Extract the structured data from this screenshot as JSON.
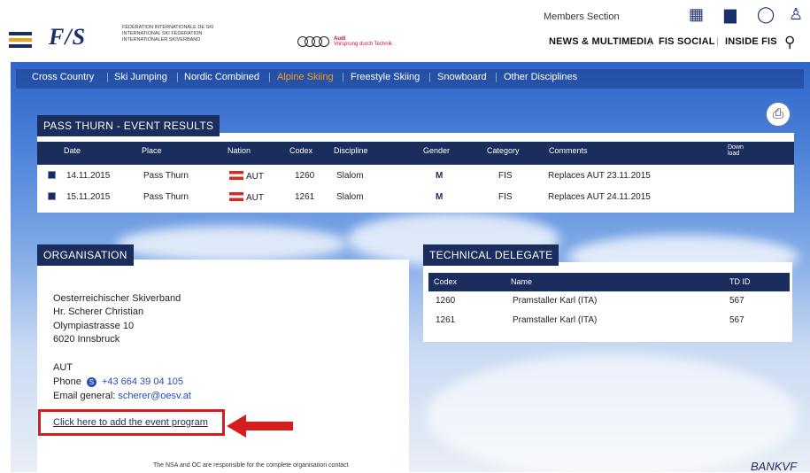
{
  "header": {
    "fis_logo": "F/S",
    "fis_subtitle": "Fédération Internationale de Ski International Ski Federation Internationaler Skiverband",
    "audi_line1": "Audi",
    "audi_line2": "Vorsprung durch Technik",
    "members_section": "Members Section",
    "nav": [
      "NEWS & MULTIMEDIA",
      "FIS SOCIAL",
      "INSIDE FIS"
    ],
    "icons": [
      "calendar-icon",
      "standings-icon",
      "medal-icon",
      "athlete-icon",
      "search-icon"
    ]
  },
  "disciplines": [
    "Cross Country",
    "Ski Jumping",
    "Nordic Combined",
    "Alpine Skiing",
    "Freestyle Skiing",
    "Snowboard",
    "Other Disciplines"
  ],
  "active_discipline": "Alpine Skiing",
  "results": {
    "title": "PASS THURN - EVENT RESULTS",
    "columns": [
      "Date",
      "Place",
      "Nation",
      "Codex",
      "Discipline",
      "Gender",
      "Category",
      "Comments",
      "Down load"
    ],
    "rows": [
      {
        "date": "14.11.2015",
        "place": "Pass Thurn",
        "nation": "AUT",
        "codex": "1260",
        "discipline": "Slalom",
        "gender": "M",
        "category": "FIS",
        "comments": "Replaces AUT 23.11.2015"
      },
      {
        "date": "15.11.2015",
        "place": "Pass Thurn",
        "nation": "AUT",
        "codex": "1261",
        "discipline": "Slalom",
        "gender": "M",
        "category": "FIS",
        "comments": "Replaces AUT 24.11.2015"
      }
    ]
  },
  "organisation": {
    "title": "ORGANISATION",
    "lines": [
      "Oesterreichischer Skiverband",
      "Hr. Scherer Christian",
      "Olympiastrasse 10",
      "6020 Innsbruck"
    ],
    "country": "AUT",
    "phone_label": "Phone",
    "phone": "+43 664 39 04 105",
    "email_label": "Email general",
    "email": "scherer@oesv.at",
    "event_program_link": "Click here to add the event program",
    "footer_note": "The NSA and OC are responsible for the complete organisation contact"
  },
  "technical_delegate": {
    "title": "TECHNICAL DELEGATE",
    "columns": [
      "Codex",
      "Name",
      "TD ID"
    ],
    "rows": [
      {
        "codex": "1260",
        "name": "Pramstaller Karl (ITA)",
        "td_id": "567"
      },
      {
        "codex": "1261",
        "name": "Pramstaller Karl (ITA)",
        "td_id": "567"
      }
    ]
  },
  "sponsor_partial": "BANKVF",
  "colors": {
    "navy": "#1b2d5c",
    "active": "#f0a020",
    "highlight_red": "#d51d1d",
    "link": "#2a4bb5"
  }
}
